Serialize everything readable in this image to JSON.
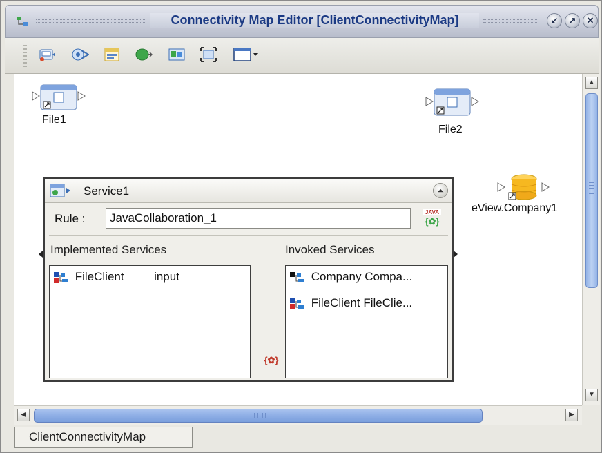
{
  "window": {
    "title": "Connectivity Map Editor [ClientConnectivityMap]",
    "buttons": [
      "minimize",
      "maximize",
      "close"
    ]
  },
  "toolbar": {
    "icons": [
      "add-file-icon",
      "add-connector-icon",
      "add-service-icon",
      "add-adapter-icon",
      "view-image-icon",
      "fit-view-icon",
      "window-dropdown-icon"
    ]
  },
  "canvas": {
    "nodes": [
      {
        "label": "File1",
        "icon": "file-external-icon"
      },
      {
        "label": "File2",
        "icon": "file-external-icon"
      },
      {
        "label": "eView.Company1",
        "icon": "database-icon"
      }
    ],
    "service": {
      "title": "Service1",
      "rule_label": "Rule :",
      "rule_value": "JavaCollaboration_1",
      "implemented_title": "Implemented Services",
      "invoked_title": "Invoked Services",
      "implemented": [
        {
          "name": "FileClient",
          "type": "input"
        }
      ],
      "invoked": [
        {
          "text": "Company Compa..."
        },
        {
          "text": "FileClient FileClie..."
        }
      ]
    }
  },
  "tabs": [
    {
      "label": "ClientConnectivityMap",
      "active": true
    }
  ],
  "colors": {
    "title_text": "#1b3a84",
    "scroll_thumb": "#8eaee6",
    "close_button": "#c0392b"
  }
}
